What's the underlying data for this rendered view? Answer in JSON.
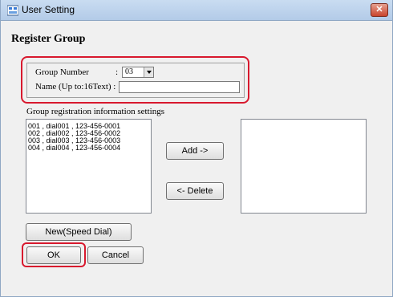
{
  "window": {
    "title": "User Setting",
    "close_label": "✕"
  },
  "page": {
    "heading": "Register Group"
  },
  "group": {
    "number_label": "Group Number",
    "number_colon": ":",
    "number_value": "03",
    "name_label": "Name (Up to:16Text) :",
    "name_value": ""
  },
  "registration": {
    "section_label": "Group registration information settings",
    "entries": [
      "001 , dial001 , 123-456-0001",
      "002 , dial002 , 123-456-0002",
      "003 , dial003 , 123-456-0003",
      "004 , dial004 , 123-456-0004"
    ],
    "add_label": "Add ->",
    "delete_label": "<- Delete"
  },
  "buttons": {
    "new_speed_dial": "New(Speed Dial)",
    "ok": "OK",
    "cancel": "Cancel"
  },
  "colors": {
    "highlight": "#d8192e",
    "titlebar": "#b3cbe8",
    "close": "#c9442d"
  }
}
